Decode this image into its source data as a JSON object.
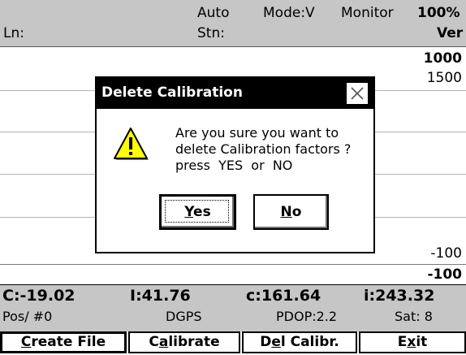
{
  "header": {
    "ln_label": "Ln:",
    "auto": "Auto",
    "stn_label": "Stn:",
    "mode": "Mode:V",
    "monitor": "Monitor",
    "percent": "100%",
    "ver": "Ver"
  },
  "plot": {
    "scale_top_bold": "1000",
    "scale_top": "1500",
    "scale_bottom": "-100",
    "scale_bottom_bold": "-100"
  },
  "status": {
    "c_upper": "C:-19.02",
    "i_upper": "I:41.76",
    "c_lower": "c:161.64",
    "i_lower": "i:243.32",
    "pos": "Pos/ #0",
    "dgps": "DGPS",
    "pdop": "PDOP:2.2",
    "sat": "Sat: 8"
  },
  "buttons": {
    "create_file": {
      "pre": "",
      "mnemonic": "C",
      "post": "reate File"
    },
    "calibrate": {
      "pre": "C",
      "mnemonic": "a",
      "post": "librate"
    },
    "del_calibr": {
      "pre": "D",
      "mnemonic": "e",
      "post": "l Calibr."
    },
    "exit": {
      "pre": "E",
      "mnemonic": "x",
      "post": "it"
    }
  },
  "dialog": {
    "title": "Delete Calibration",
    "icon": "warning-icon",
    "message_lines": [
      "Are you sure you want to",
      "delete Calibration factors ?",
      "press  YES  or  NO"
    ],
    "yes": {
      "mnemonic": "Y",
      "rest": "es"
    },
    "no": {
      "mnemonic": "N",
      "rest": "o"
    }
  },
  "colors": {
    "panel_gray": "#c6c6c6",
    "titlebar": "#000000",
    "warning_yellow": "#ffff00"
  }
}
